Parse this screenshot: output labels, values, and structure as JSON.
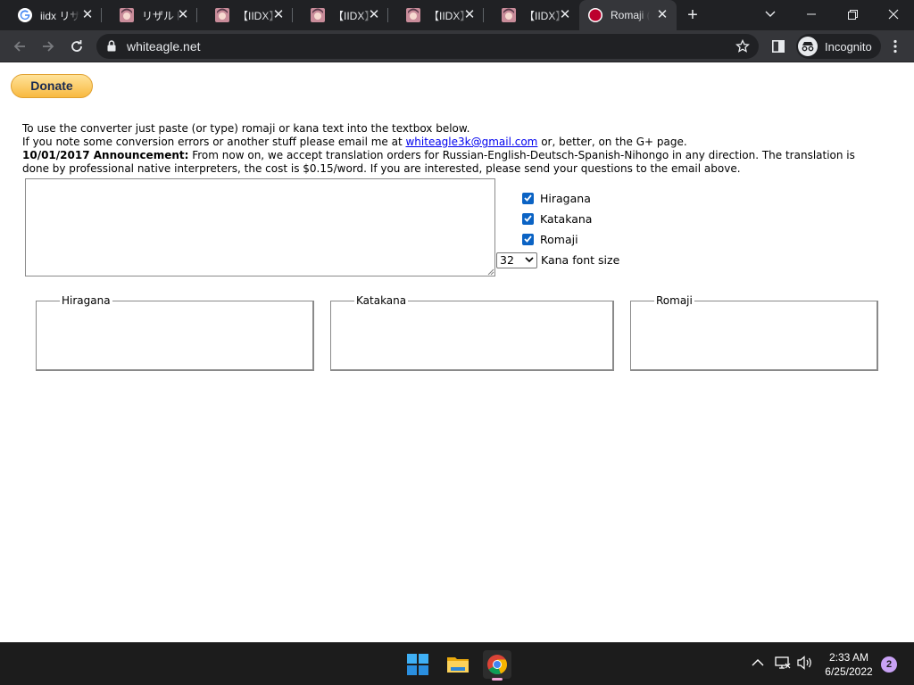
{
  "browser": {
    "tabs": [
      {
        "title": "iidx リザルト",
        "favicon": "google-icon",
        "active": false
      },
      {
        "title": "リザルト (",
        "favicon": "anime-avatar-icon",
        "active": false
      },
      {
        "title": "【IIDX】C",
        "favicon": "anime-avatar-icon",
        "active": false
      },
      {
        "title": "【IIDX】C",
        "favicon": "anime-avatar-icon",
        "active": false
      },
      {
        "title": "【IIDX】B",
        "favicon": "anime-avatar-icon",
        "active": false
      },
      {
        "title": "【IIDX】B",
        "favicon": "anime-avatar-icon",
        "active": false
      },
      {
        "title": "Romaji (",
        "favicon": "japan-flag-icon",
        "active": true
      }
    ],
    "address": "whiteagle.net",
    "profile_label": "Incognito"
  },
  "page": {
    "donate_label": "Donate",
    "intro_line1": "To use the converter just paste (or type) romaji or kana text into the textbox below.",
    "intro_line2_before": "If you note some conversion errors or another stuff please email me at ",
    "email": "whiteagle3k@gmail.com",
    "intro_line2_after": " or, better, on the G+ page.",
    "announcement_heading": "10/01/2017 Announcement:",
    "announcement_text": " From now on, we accept translation orders for Russian-English-Deutsch-Spanish-Nihongo in any direction. The translation is done by professional native interpreters, the cost is $0.15/word. If you are interested, please send your questions to the email above.",
    "input_text": "",
    "options": [
      {
        "label": "Hiragana",
        "checked": true
      },
      {
        "label": "Katakana",
        "checked": true
      },
      {
        "label": "Romaji",
        "checked": true
      }
    ],
    "font_size_value": "32",
    "font_size_label": "Kana font size",
    "outputs": [
      {
        "legend": "Hiragana",
        "content": ""
      },
      {
        "legend": "Katakana",
        "content": ""
      },
      {
        "legend": "Romaji",
        "content": ""
      }
    ]
  },
  "taskbar": {
    "time": "2:33 AM",
    "date": "6/25/2022",
    "notification_count": "2"
  },
  "colors": {
    "checkbox_accent": "#0b63c4",
    "link": "#0000ee",
    "donate_gradient_top": "#ffe39a",
    "donate_gradient_bottom": "#f8b940"
  }
}
